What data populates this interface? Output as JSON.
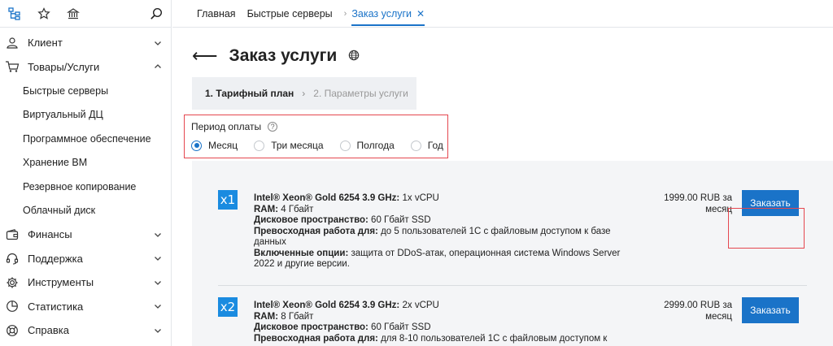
{
  "sidebar": {
    "top_icons": [
      "sitemap-icon",
      "star-icon",
      "bank-icon",
      "search-icon"
    ],
    "items": [
      {
        "label": "Клиент",
        "icon": "user-icon",
        "expanded": false
      },
      {
        "label": "Товары/Услуги",
        "icon": "cart-icon",
        "expanded": true
      },
      {
        "label": "Финансы",
        "icon": "wallet-icon",
        "expanded": false
      },
      {
        "label": "Поддержка",
        "icon": "headset-icon",
        "expanded": false
      },
      {
        "label": "Инструменты",
        "icon": "gear-icon",
        "expanded": false
      },
      {
        "label": "Статистика",
        "icon": "pie-chart-icon",
        "expanded": false
      },
      {
        "label": "Справка",
        "icon": "lifebuoy-icon",
        "expanded": false
      }
    ],
    "subitems": [
      "Быстрые серверы",
      "Виртуальный ДЦ",
      "Программное обеспечение",
      "Хранение ВМ",
      "Резервное копирование",
      "Облачный диск"
    ]
  },
  "topbar": {
    "crumbs": [
      "Главная",
      "Быстрые серверы"
    ],
    "active": "Заказ услуги"
  },
  "page": {
    "title": "Заказ услуги",
    "steps": {
      "step1": "1. Тарифный план",
      "step2": "2. Параметры услуги"
    },
    "period": {
      "label": "Период оплаты",
      "options": [
        "Месяц",
        "Три месяца",
        "Полгода",
        "Год"
      ],
      "selected": "Месяц"
    }
  },
  "plans": [
    {
      "badge": "x1",
      "cpu_label": "Intel® Xeon® Gold 6254 3.9 GHz:",
      "cpu_value": " 1x vCPU",
      "ram_label": "RAM:",
      "ram_value": " 4 Гбайт",
      "disk_label": "Дисковое пространство:",
      "disk_value": " 60 Гбайт SSD",
      "perf_label": "Превосходная работа для:",
      "perf_value": " до 5 пользователей 1С с файловым доступом к базе данных",
      "opts_label": "Включенные опции:",
      "opts_value": " защита от DDoS-атак, операционная система Windows Server 2022 и другие версии.",
      "price_line1": "1999.00 RUB за",
      "price_line2": "месяц",
      "button": "Заказать"
    },
    {
      "badge": "x2",
      "cpu_label": "Intel® Xeon® Gold 6254 3.9 GHz:",
      "cpu_value": " 2x vCPU",
      "ram_label": "RAM:",
      "ram_value": " 8 Гбайт",
      "disk_label": "Дисковое пространство:",
      "disk_value": " 60 Гбайт SSD",
      "perf_label": "Превосходная работа для:",
      "perf_value": " для 8-10 пользователей 1С с файловым доступом к",
      "price_line1": "2999.00 RUB за",
      "price_line2": "месяц",
      "button": "Заказать"
    }
  ],
  "colors": {
    "accent": "#1a73c8",
    "highlight": "#e5474f"
  }
}
